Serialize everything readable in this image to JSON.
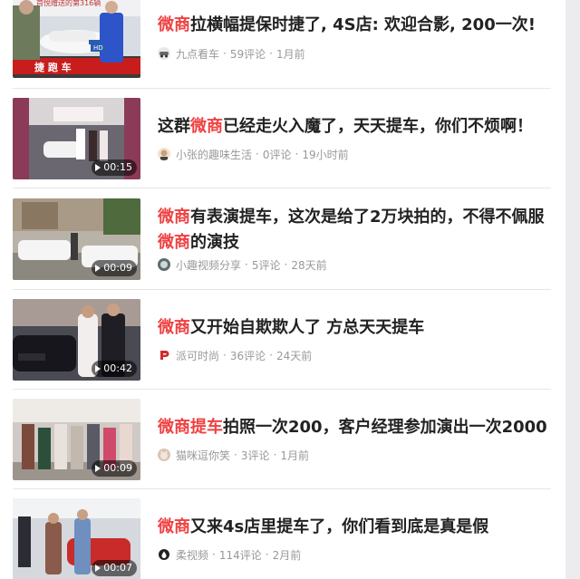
{
  "colors": {
    "keyword": "#f04142",
    "title": "#222222",
    "meta": "#999999",
    "separator": "#e6e6e6",
    "scrollbar_track": "#ececef"
  },
  "articles": [
    {
      "title": [
        {
          "text": "微商",
          "highlight": true
        },
        {
          "text": "拉横幅提保时捷了, 4S店: 欢迎合影, 200一次!",
          "highlight": false
        }
      ],
      "source": "九点看车",
      "comments": "59评论",
      "time": "1月前",
      "duration": "",
      "thumb_caption_top": "首悦赠送的第316辆",
      "thumb_caption_bottom": "捷 跑 车",
      "thumb_plate": "HD",
      "avatar_icon": "car-logo-icon"
    },
    {
      "title": [
        {
          "text": "这群",
          "highlight": false
        },
        {
          "text": "微商",
          "highlight": true
        },
        {
          "text": "已经走火入魔了，天天提车，你们不烦啊！",
          "highlight": false
        }
      ],
      "source": "小张的趣味生活",
      "comments": "0评论",
      "time": "19小时前",
      "duration": "00:15",
      "avatar_icon": "person-avatar-icon"
    },
    {
      "title": [
        {
          "text": "微商",
          "highlight": true
        },
        {
          "text": "有表演提车，这次是给了2万块拍的，不得不佩服",
          "highlight": false
        },
        {
          "text": "微商",
          "highlight": true
        },
        {
          "text": "的演技",
          "highlight": false
        }
      ],
      "source": "小趣视频分享",
      "comments": "5评论",
      "time": "28天前",
      "duration": "00:09",
      "avatar_icon": "channel-avatar-icon"
    },
    {
      "title": [
        {
          "text": "微商",
          "highlight": true
        },
        {
          "text": "又开始自欺欺人了 方总天天提车",
          "highlight": false
        }
      ],
      "source": "派可时尚",
      "comments": "36评论",
      "time": "24天前",
      "duration": "00:42",
      "avatar_icon": "brand-p-logo-icon"
    },
    {
      "title": [
        {
          "text": "微商提车",
          "highlight": true
        },
        {
          "text": "拍照一次200，客户经理参加演出一次2000",
          "highlight": false
        }
      ],
      "source": "猫咪逗你笑",
      "comments": "3评论",
      "time": "1月前",
      "duration": "00:09",
      "avatar_icon": "cat-avatar-icon"
    },
    {
      "title": [
        {
          "text": "微商",
          "highlight": true
        },
        {
          "text": "又来4s店里提车了，你们看到底是真是假",
          "highlight": false
        }
      ],
      "source": "柔视频",
      "comments": "114评论",
      "time": "2月前",
      "duration": "00:07",
      "avatar_icon": "drop-logo-icon"
    }
  ]
}
